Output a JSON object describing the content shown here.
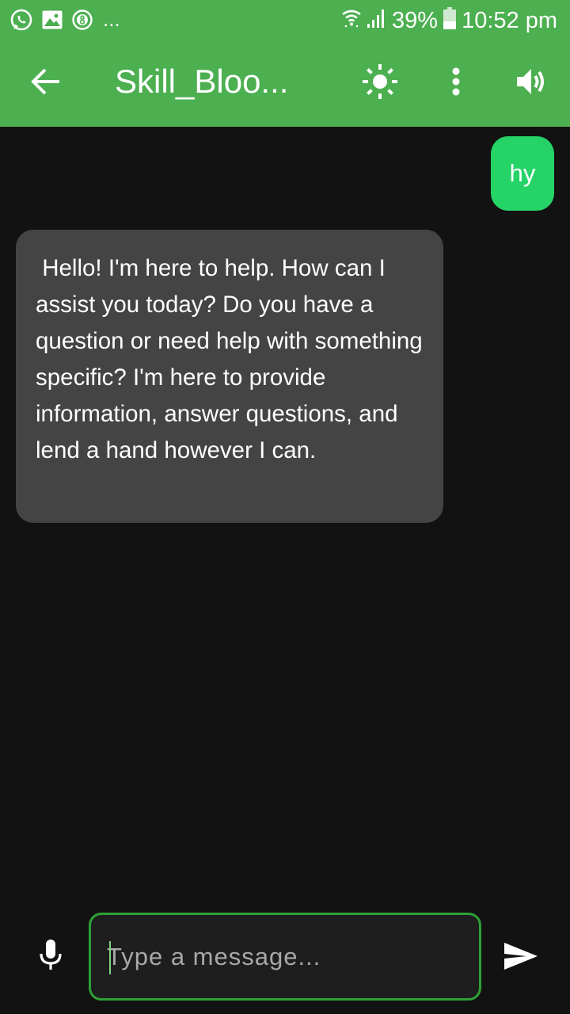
{
  "status_bar": {
    "left_icons": [
      "whatsapp-icon",
      "gallery-icon",
      "notification-badge-icon"
    ],
    "overflow_indicator": "...",
    "battery_percent": "39%",
    "time": "10:52 pm"
  },
  "app_bar": {
    "title": "Skill_Bloo...",
    "icons": [
      "back-arrow-icon",
      "brightness-icon",
      "more-vert-icon",
      "volume-icon"
    ]
  },
  "messages": [
    {
      "sender": "user",
      "text": "hy"
    },
    {
      "sender": "bot",
      "text": " Hello! I'm here to help. How can I assist you today? Do you have a question or need help with something specific? I'm here to provide information, answer questions, and lend a hand however I can."
    }
  ],
  "composer": {
    "placeholder": "Type a message...",
    "value": ""
  },
  "colors": {
    "app_bar": "#4caf50",
    "background": "#121212",
    "user_bubble": "#25d366",
    "bot_bubble": "#444444",
    "input_border": "#2ea036"
  }
}
